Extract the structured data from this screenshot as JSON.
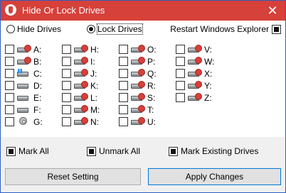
{
  "window": {
    "title": "Hide Or Lock Drives",
    "close_glyph": "✕",
    "accent_color": "#d6413a"
  },
  "mode": {
    "hide_label": "Hide Drives",
    "lock_label": "Lock Drives",
    "selected": "lock",
    "restart_label": "Restart Windows Explorer",
    "restart_checked": true
  },
  "drives": [
    [
      {
        "label": "A:",
        "icon": "locked-drive-icon",
        "checked": false
      },
      {
        "label": "B:",
        "icon": "locked-drive-icon",
        "checked": false
      },
      {
        "label": "C:",
        "icon": "windows-drive-icon",
        "checked": false
      },
      {
        "label": "D:",
        "icon": "hard-drive-icon",
        "checked": false
      },
      {
        "label": "E:",
        "icon": "hard-drive-icon",
        "checked": false
      },
      {
        "label": "F:",
        "icon": "hard-drive-icon",
        "checked": false
      },
      {
        "label": "G:",
        "icon": "cd-drive-icon",
        "checked": false
      }
    ],
    [
      {
        "label": "H:",
        "icon": "locked-drive-icon",
        "checked": false
      },
      {
        "label": "I:",
        "icon": "locked-drive-icon",
        "checked": false
      },
      {
        "label": "J:",
        "icon": "locked-drive-icon",
        "checked": false
      },
      {
        "label": "K:",
        "icon": "locked-drive-icon",
        "checked": false
      },
      {
        "label": "L:",
        "icon": "locked-drive-icon",
        "checked": false
      },
      {
        "label": "M:",
        "icon": "locked-drive-icon",
        "checked": false
      },
      {
        "label": "N:",
        "icon": "locked-drive-icon",
        "checked": false
      }
    ],
    [
      {
        "label": "O:",
        "icon": "locked-drive-icon",
        "checked": false
      },
      {
        "label": "P:",
        "icon": "locked-drive-icon",
        "checked": false
      },
      {
        "label": "Q:",
        "icon": "locked-drive-icon",
        "checked": false
      },
      {
        "label": "R:",
        "icon": "locked-drive-icon",
        "checked": false
      },
      {
        "label": "S:",
        "icon": "locked-drive-icon",
        "checked": false
      },
      {
        "label": "T:",
        "icon": "locked-drive-icon",
        "checked": false
      },
      {
        "label": "U:",
        "icon": "locked-drive-icon",
        "checked": false
      }
    ],
    [
      {
        "label": "V:",
        "icon": "locked-drive-icon",
        "checked": false
      },
      {
        "label": "W:",
        "icon": "locked-drive-icon",
        "checked": false
      },
      {
        "label": "X:",
        "icon": "locked-drive-icon",
        "checked": false
      },
      {
        "label": "Y:",
        "icon": "locked-drive-icon",
        "checked": false
      },
      {
        "label": "Z:",
        "icon": "locked-drive-icon",
        "checked": false
      }
    ]
  ],
  "bulk": {
    "mark_all": "Mark All",
    "unmark_all": "Unmark All",
    "mark_existing": "Mark Existing Drives"
  },
  "actions": {
    "reset": "Reset Setting",
    "apply": "Apply Changes"
  }
}
